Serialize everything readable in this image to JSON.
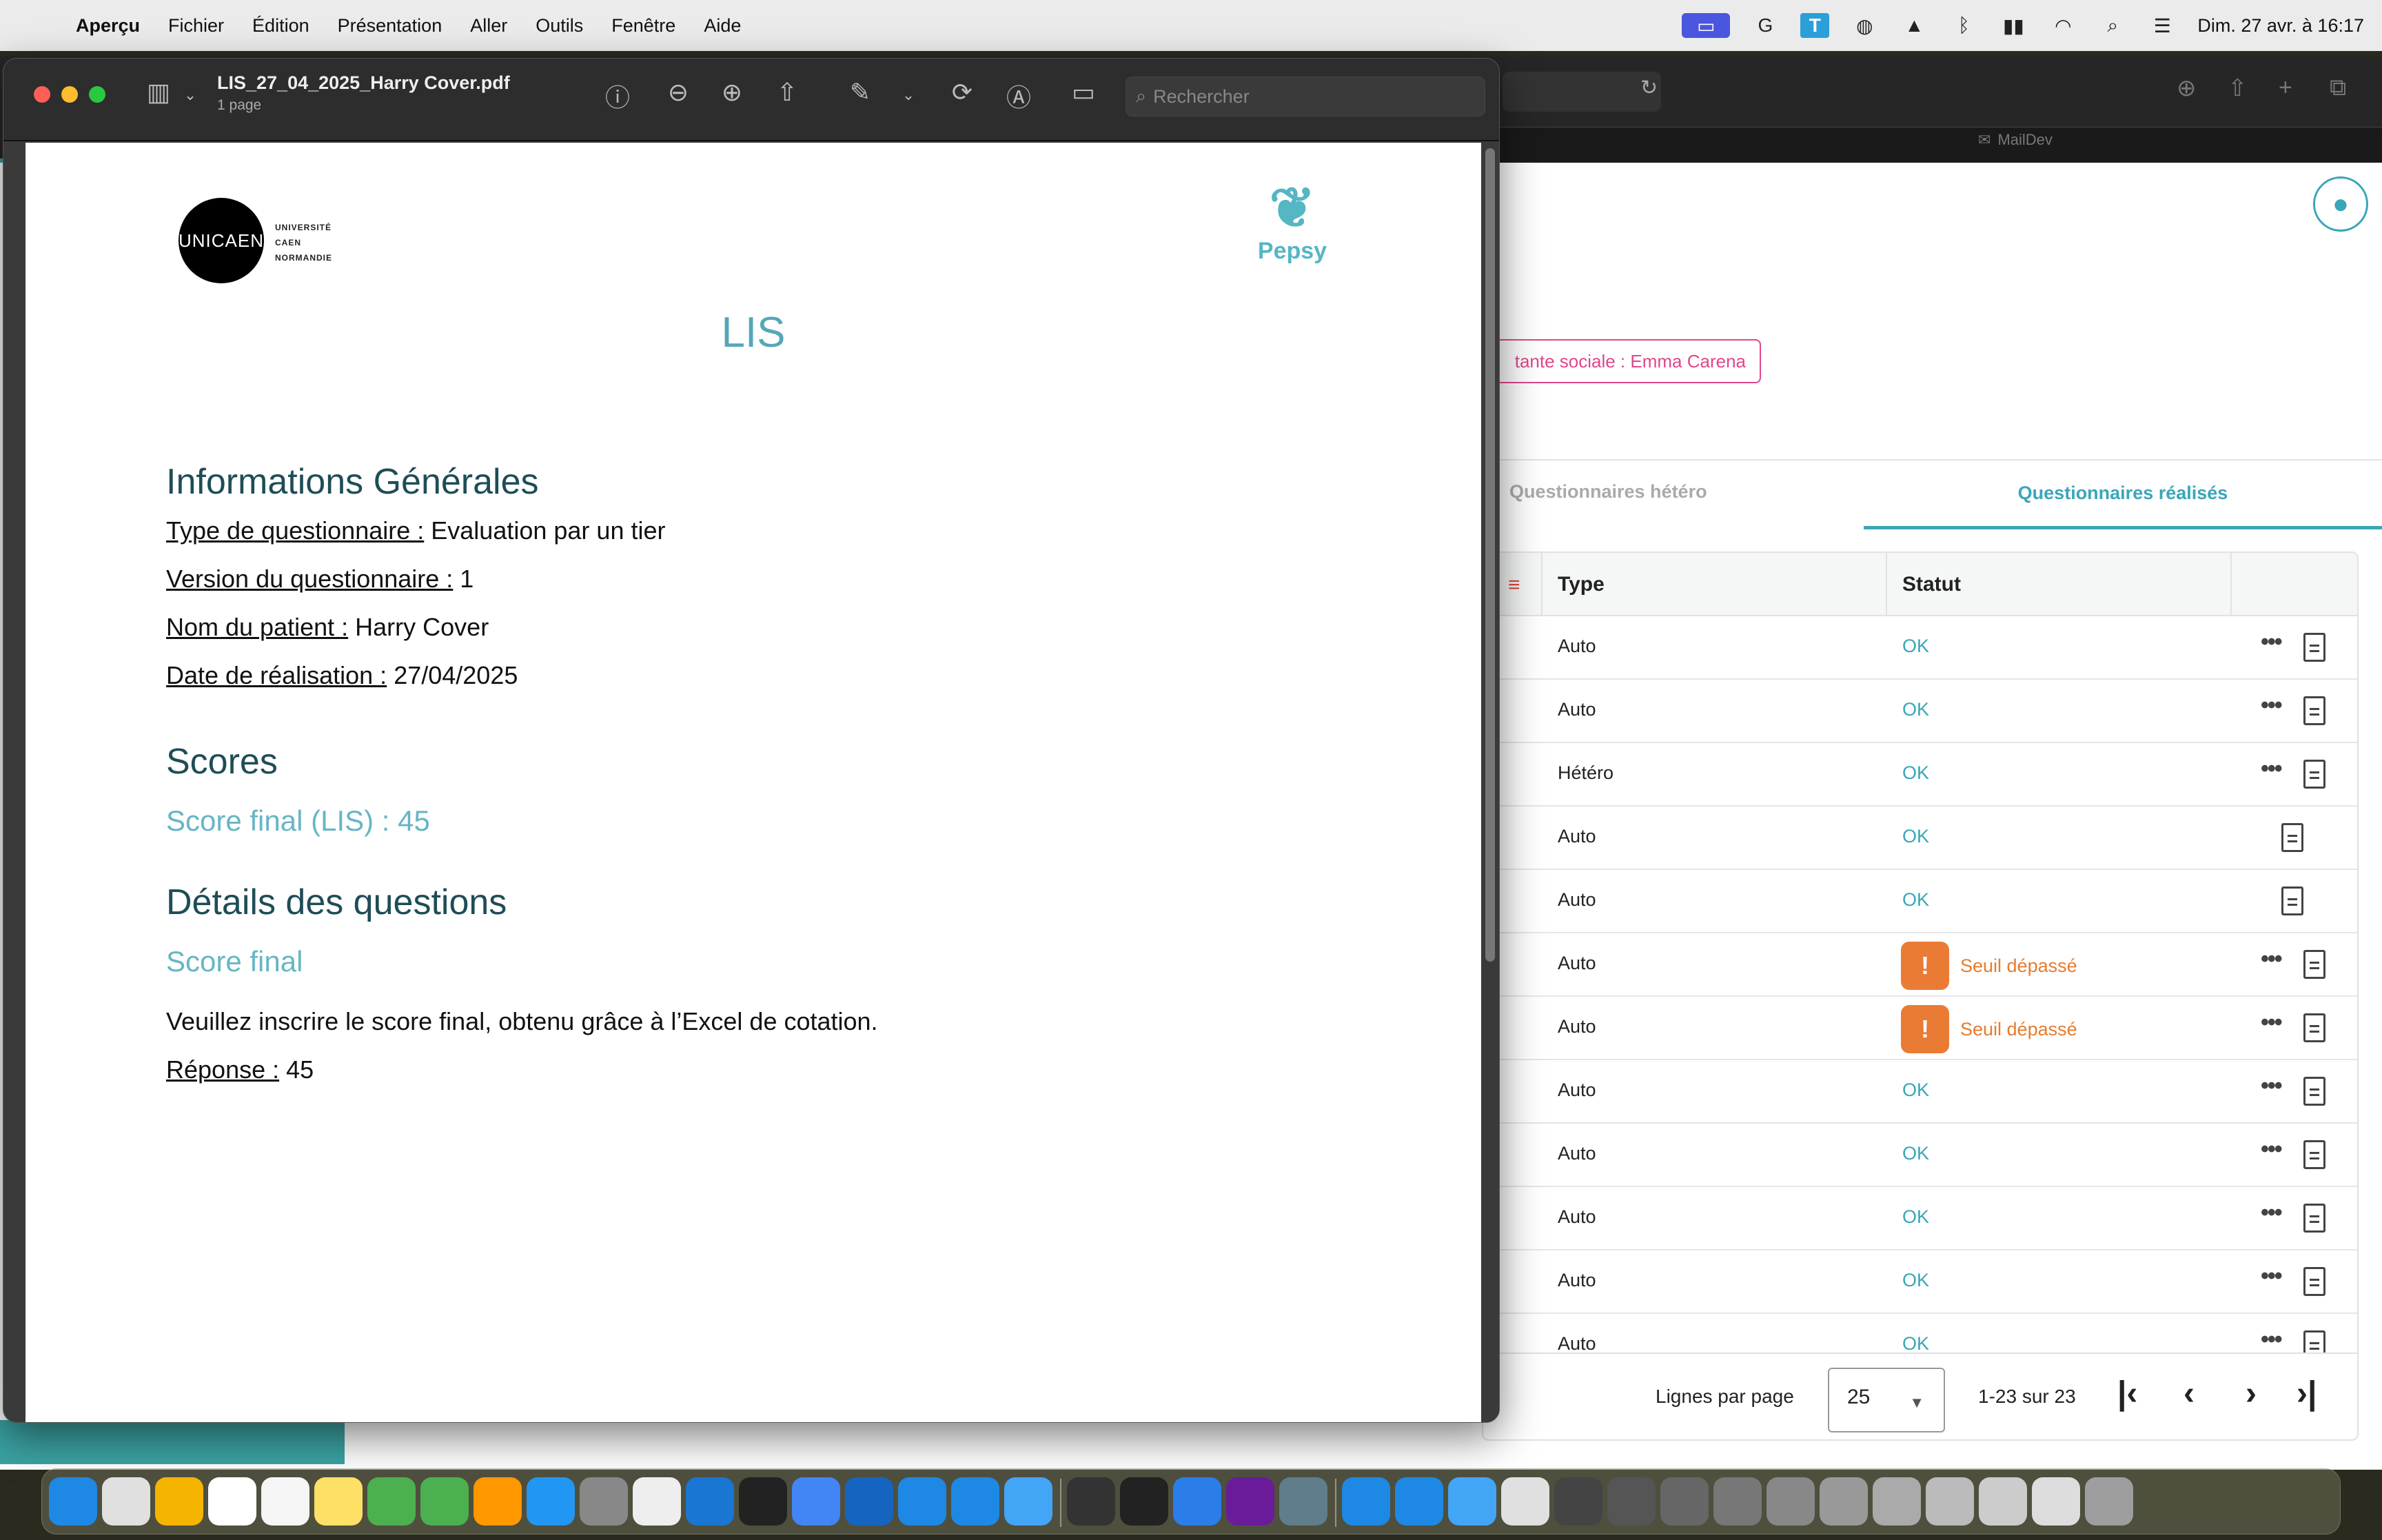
{
  "menubar": {
    "app": "Aperçu",
    "items": [
      "Fichier",
      "Édition",
      "Présentation",
      "Aller",
      "Outils",
      "Fenêtre",
      "Aide"
    ],
    "clock": "Dim. 27 avr. à 16:17"
  },
  "browser": {
    "tab_mail": "MailDev"
  },
  "app": {
    "chip": "tante sociale : Emma Carena",
    "tabs": [
      "Questionnaires hétéro",
      "Questionnaires réalisés"
    ],
    "table": {
      "headers": [
        "Type",
        "Statut"
      ],
      "rows": [
        {
          "type": "Auto",
          "status": "OK",
          "warn": false,
          "dots": true
        },
        {
          "type": "Auto",
          "status": "OK",
          "warn": false,
          "dots": true
        },
        {
          "type": "Hétéro",
          "status": "OK",
          "warn": false,
          "dots": true
        },
        {
          "type": "Auto",
          "status": "OK",
          "warn": false,
          "dots": false
        },
        {
          "type": "Auto",
          "status": "OK",
          "warn": false,
          "dots": false
        },
        {
          "type": "Auto",
          "status": "Seuil dépassé",
          "warn": true,
          "dots": true
        },
        {
          "type": "Auto",
          "status": "Seuil dépassé",
          "warn": true,
          "dots": true
        },
        {
          "type": "Auto",
          "status": "OK",
          "warn": false,
          "dots": true
        },
        {
          "type": "Auto",
          "status": "OK",
          "warn": false,
          "dots": true
        },
        {
          "type": "Auto",
          "status": "OK",
          "warn": false,
          "dots": true
        },
        {
          "type": "Auto",
          "status": "OK",
          "warn": false,
          "dots": true
        },
        {
          "type": "Auto",
          "status": "OK",
          "warn": false,
          "dots": true
        }
      ]
    },
    "pager": {
      "label": "Lignes par page",
      "per_page": "25",
      "range": "1-23 sur 23"
    }
  },
  "preview": {
    "filename": "LIS_27_04_2025_Harry Cover.pdf",
    "pages": "1 page",
    "search_placeholder": "Rechercher"
  },
  "pdf": {
    "logo_left": "UNICAEN",
    "logo_left_text": [
      "UNIVERSITÉ",
      "CAEN",
      "NORMANDIE"
    ],
    "logo_right": "Pepsy",
    "title": "LIS",
    "section_info": "Informations Générales",
    "info": [
      {
        "label": "Type de questionnaire :",
        "value": " Evaluation par un tier"
      },
      {
        "label": "Version du questionnaire :",
        "value": " 1"
      },
      {
        "label": "Nom du patient :",
        "value": " Harry Cover"
      },
      {
        "label": "Date de réalisation :",
        "value": " 27/04/2025"
      }
    ],
    "section_scores": "Scores",
    "score_final": "Score final (LIS) : 45",
    "section_details": "Détails des questions",
    "question_title": "Score final",
    "question_text": "Veuillez inscrire le score final, obtenu grâce à l’Excel de cotation.",
    "answer_label": "Réponse :",
    "answer_value": " 45"
  },
  "colors": {
    "accent": "#3aa6b9",
    "warning": "#ea7b34",
    "chip": "#e0468c"
  }
}
